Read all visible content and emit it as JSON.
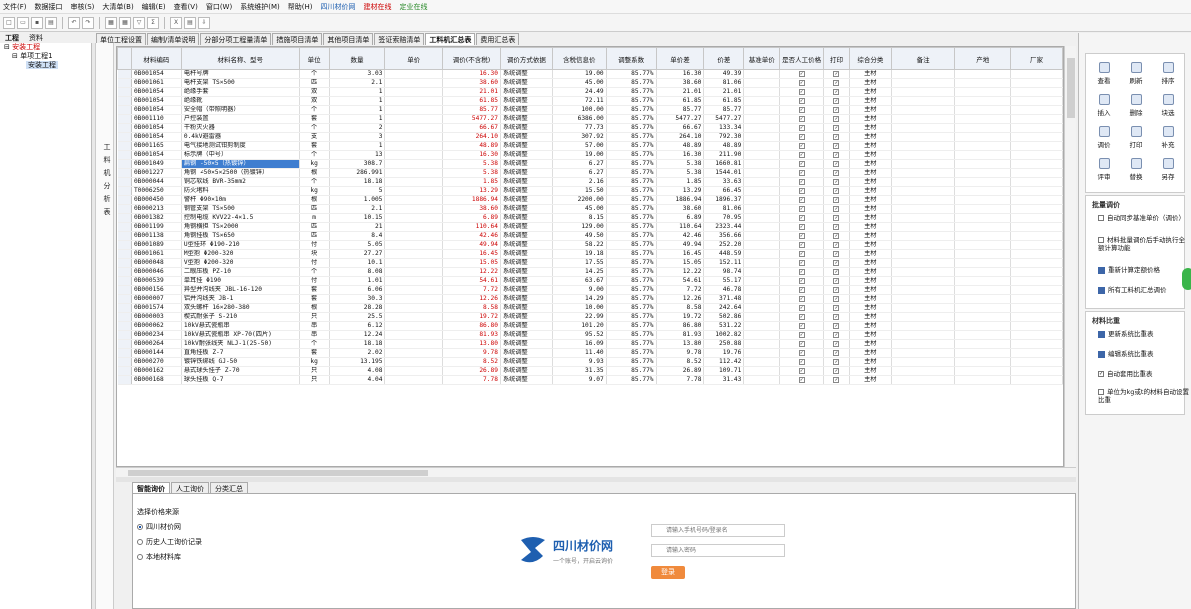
{
  "menu": [
    "文件(F)",
    "数据接口",
    "审核(S)",
    "大清单(B)",
    "编辑(E)",
    "查看(V)",
    "窗口(W)",
    "系统维护(M)",
    "帮助(H)",
    "四川材价网",
    "建材在线",
    "定业在线"
  ],
  "left_tabs": [
    "工程",
    "资料"
  ],
  "tree": [
    "安装工程",
    "单项工程1",
    "安装工程"
  ],
  "side_labels": [
    "工料机分析表"
  ],
  "main_tabs": [
    "单位工程设置",
    "编制/清单说明",
    "分部分项工程量清单",
    "措施项目清单",
    "其他项目清单",
    "签证索赔清单",
    "工料机汇总表",
    "费用汇总表"
  ],
  "columns": [
    "材料编码",
    "材料名称、型号",
    "单位",
    "数量",
    "单价",
    "调价(不含税)",
    "调价方式依据",
    "含税信息价",
    "调整系数",
    "单价差",
    "价差",
    "基准单价",
    "是否人工价格",
    "打印",
    "综合分类",
    "备注",
    "产地",
    "厂家"
  ],
  "rows": [
    [
      "0B001054",
      "电杆号牌",
      "个",
      "3.03",
      "16.30",
      "系统调整",
      "19.00",
      "85.77%",
      "16.30",
      "49.39",
      "主材"
    ],
    [
      "0B001061",
      "电杆支架 TS×500",
      "匹",
      "2.1",
      "38.60",
      "系统调整",
      "45.00",
      "85.77%",
      "38.60",
      "81.06",
      "主材"
    ],
    [
      "0B001054",
      "绝缘手套",
      "双",
      "1",
      "21.01",
      "系统调整",
      "24.49",
      "85.77%",
      "21.01",
      "21.01",
      "主材"
    ],
    [
      "0B001054",
      "绝缘靴",
      "双",
      "1",
      "61.85",
      "系统调整",
      "72.11",
      "85.77%",
      "61.85",
      "61.85",
      "主材"
    ],
    [
      "0B001054",
      "安全帽（带照明器）",
      "个",
      "1",
      "85.77",
      "系统调整",
      "100.00",
      "85.77%",
      "85.77",
      "85.77",
      "主材"
    ],
    [
      "0B001110",
      "户控装置",
      "套",
      "1",
      "5477.27",
      "系统调整",
      "6386.00",
      "85.77%",
      "5477.27",
      "5477.27",
      "主材"
    ],
    [
      "0B001054",
      "干粉灭火器",
      "个",
      "2",
      "66.67",
      "系统调整",
      "77.73",
      "85.77%",
      "66.67",
      "133.34",
      "主材"
    ],
    [
      "0B001054",
      "0.4kV避雷器",
      "支",
      "3",
      "264.10",
      "系统调整",
      "307.92",
      "85.77%",
      "264.10",
      "792.30",
      "主材"
    ],
    [
      "0B001165",
      "电气接地测试钳剪制度",
      "套",
      "1",
      "48.89",
      "系统调整",
      "57.00",
      "85.77%",
      "48.89",
      "48.89",
      "主材"
    ],
    [
      "0B001054",
      "标示牌（中号）",
      "个",
      "13",
      "16.30",
      "系统调整",
      "19.00",
      "85.77%",
      "16.30",
      "211.90",
      "主材"
    ],
    [
      "0B001049",
      "扁钢 -50×5（热镀锌）",
      "kg",
      "308.7",
      "5.38",
      "系统调整",
      "6.27",
      "85.77%",
      "5.38",
      "1660.81",
      "主材"
    ],
    [
      "0B001227",
      "角钢 ∠50×5×2500（热镀锌）",
      "根",
      "286.991",
      "5.38",
      "系统调整",
      "6.27",
      "85.77%",
      "5.38",
      "1544.01",
      "主材"
    ],
    [
      "0B000044",
      "铜芯软线 BVR-35mm2",
      "个",
      "18.18",
      "1.85",
      "系统调整",
      "2.16",
      "85.77%",
      "1.85",
      "33.63",
      "主材"
    ],
    [
      "T0006250",
      "防火堵料",
      "kg",
      "5",
      "13.29",
      "系统调整",
      "15.50",
      "85.77%",
      "13.29",
      "66.45",
      "主材"
    ],
    [
      "0B000450",
      "警杆 Φ90×10m",
      "根",
      "1.005",
      "1886.94",
      "系统调整",
      "2200.00",
      "85.77%",
      "1886.94",
      "1896.37",
      "主材"
    ],
    [
      "0B000213",
      "钢管支架 TS×500",
      "匹",
      "2.1",
      "38.60",
      "系统调整",
      "45.00",
      "85.77%",
      "38.60",
      "81.06",
      "主材"
    ],
    [
      "0B001382",
      "控制电缆 KVV22-4×1.5",
      "m",
      "10.15",
      "6.89",
      "系统调整",
      "8.15",
      "85.77%",
      "6.89",
      "70.95",
      "主材"
    ],
    [
      "0B001199",
      "角钢横担 TS×2000",
      "匹",
      "21",
      "110.64",
      "系统调整",
      "129.00",
      "85.77%",
      "110.64",
      "2323.44",
      "主材"
    ],
    [
      "0B001138",
      "角钢挂板 TS×650",
      "匹",
      "8.4",
      "42.46",
      "系统调整",
      "49.50",
      "85.77%",
      "42.46",
      "356.66",
      "主材"
    ],
    [
      "0B001089",
      "U型挂环 Φ190-210",
      "付",
      "5.05",
      "49.94",
      "系统调整",
      "58.22",
      "85.77%",
      "49.94",
      "252.20",
      "主材"
    ],
    [
      "0B001061",
      "M型抱 Φ200-320",
      "块",
      "27.27",
      "16.45",
      "系统调整",
      "19.18",
      "85.77%",
      "16.45",
      "448.59",
      "主材"
    ],
    [
      "0B000048",
      "V型抱 Φ200-320",
      "付",
      "10.1",
      "15.05",
      "系统调整",
      "17.55",
      "85.77%",
      "15.05",
      "152.11",
      "主材"
    ],
    [
      "0B000046",
      "二眼压板 PZ-10",
      "个",
      "8.08",
      "12.22",
      "系统调整",
      "14.25",
      "85.77%",
      "12.22",
      "98.74",
      "主材"
    ],
    [
      "0B000539",
      "单耳挂 Φ190",
      "付",
      "1.01",
      "54.61",
      "系统调整",
      "63.67",
      "85.77%",
      "54.61",
      "55.17",
      "主材"
    ],
    [
      "0B000156",
      "异型并沟线夹 JBL-16-120",
      "套",
      "6.06",
      "7.72",
      "系统调整",
      "9.00",
      "85.77%",
      "7.72",
      "46.78",
      "主材"
    ],
    [
      "0B000007",
      "铝并沟线夹 JB-1",
      "套",
      "30.3",
      "12.26",
      "系统调整",
      "14.29",
      "85.77%",
      "12.26",
      "371.48",
      "主材"
    ],
    [
      "0B001574",
      "双头螺杆 16×280-380",
      "根",
      "28.28",
      "8.58",
      "系统调整",
      "10.00",
      "85.77%",
      "8.58",
      "242.64",
      "主材"
    ],
    [
      "0B000003",
      "楔式耐张子 S-210",
      "只",
      "25.5",
      "19.72",
      "系统调整",
      "22.99",
      "85.77%",
      "19.72",
      "502.86",
      "主材"
    ],
    [
      "0B000062",
      "10kV悬式瓷瓶串",
      "串",
      "6.12",
      "86.80",
      "系统调整",
      "101.20",
      "85.77%",
      "86.80",
      "531.22",
      "主材"
    ],
    [
      "0B000234",
      "10kV悬式瓷瓶串 XP-70(四片)",
      "串",
      "12.24",
      "81.93",
      "系统调整",
      "95.52",
      "85.77%",
      "81.93",
      "1002.82",
      "主材"
    ],
    [
      "0B000264",
      "10kV耐张线夹 NLJ-1(25-50)",
      "个",
      "18.18",
      "13.80",
      "系统调整",
      "16.09",
      "85.77%",
      "13.80",
      "250.88",
      "主材"
    ],
    [
      "0B000144",
      "直角挂板 Z-7",
      "套",
      "2.02",
      "9.78",
      "系统调整",
      "11.40",
      "85.77%",
      "9.78",
      "19.76",
      "主材"
    ],
    [
      "0B000270",
      "镀锌铁绑线 GJ-50",
      "kg",
      "13.195",
      "8.52",
      "系统调整",
      "9.93",
      "85.77%",
      "8.52",
      "112.42",
      "主材"
    ],
    [
      "0B000162",
      "悬式球头挂子 Z-70",
      "只",
      "4.08",
      "26.89",
      "系统调整",
      "31.35",
      "85.77%",
      "26.89",
      "109.71",
      "主材"
    ],
    [
      "0B000168",
      "球头挂板 Q-7",
      "只",
      "4.04",
      "7.78",
      "系统调整",
      "9.07",
      "85.77%",
      "7.78",
      "31.43",
      "主材"
    ]
  ],
  "selected_row": 10,
  "bottom_tabs": [
    "智能询价",
    "人工询价",
    "分类汇总"
  ],
  "source": {
    "title": "选择价格来源",
    "options": [
      "四川材价网",
      "历史人工询价记录",
      "本地材料库"
    ]
  },
  "brand": {
    "name": "四川材价网",
    "slogan": "一个账号，开启云询价"
  },
  "login": {
    "user_ph": "请输入手机号码/登录名",
    "pwd_ph": "请输入密码",
    "btn": "登录"
  },
  "right_buttons": [
    "查看",
    "刷新",
    "排序",
    "插入",
    "删除",
    "块选",
    "调价",
    "打印",
    "补充",
    "评审",
    "替换",
    "另存"
  ],
  "batch": {
    "title": "批量调价",
    "opt1": "自动同步基准单价（调价）",
    "opt2": "材料批量调价后手动执行全额计算功能",
    "btn1": "重新计算定额价格",
    "btn2": "所有工料机汇总调价"
  },
  "compare": {
    "title": "材料比重",
    "btn1": "更新系统比重表",
    "btn2": "编辑系统比重表",
    "opt1": "自动套用比重表",
    "opt2": "单位为kg或t的材料自动设置比重"
  },
  "colors": {
    "accent": "#3f7ed0",
    "red": "#cc0000",
    "orange": "#f08a3c",
    "brand": "#1e5fb0"
  }
}
